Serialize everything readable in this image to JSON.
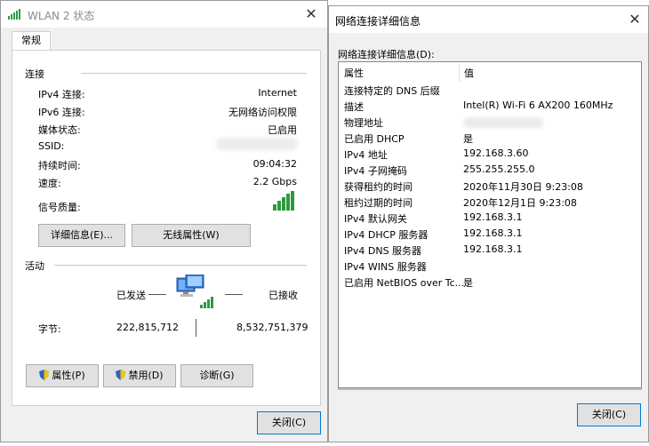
{
  "wlan_window": {
    "title": "WLAN 2 状态",
    "close_glyph": "✕",
    "tab": "常规",
    "connection": {
      "heading": "连接",
      "rows": [
        {
          "label": "IPv4 连接:",
          "value": "Internet"
        },
        {
          "label": "IPv6 连接:",
          "value": "无网络访问权限"
        },
        {
          "label": "媒体状态:",
          "value": "已启用"
        },
        {
          "label": "SSID:",
          "value": ""
        },
        {
          "label": "持续时间:",
          "value": "09:04:32"
        },
        {
          "label": "速度:",
          "value": "2.2 Gbps"
        },
        {
          "label": "信号质量:",
          "value": ""
        }
      ],
      "signal_bars": 5,
      "signal_color": "#2e9a3e"
    },
    "details_button": "详细信息(E)...",
    "wireless_props_button": "无线属性(W)",
    "activity": {
      "heading": "活动",
      "sent_label": "已发送",
      "received_label": "已接收",
      "bytes_label": "字节:",
      "bytes_sent": "222,815,712",
      "bytes_received": "8,532,751,379"
    },
    "properties_button": "属性(P)",
    "disable_button": "禁用(D)",
    "diagnose_button": "诊断(G)",
    "close_button": "关闭(C)"
  },
  "details_window": {
    "title": "网络连接详细信息",
    "close_glyph": "✕",
    "sub_label": "网络连接详细信息(D):",
    "col_property": "属性",
    "col_value": "值",
    "rows": [
      {
        "k": "连接特定的 DNS 后缀",
        "v": ""
      },
      {
        "k": "描述",
        "v": "Intel(R) Wi-Fi 6 AX200 160MHz"
      },
      {
        "k": "物理地址",
        "v": ""
      },
      {
        "k": "已启用 DHCP",
        "v": "是"
      },
      {
        "k": "IPv4 地址",
        "v": "192.168.3.60"
      },
      {
        "k": "IPv4 子网掩码",
        "v": "255.255.255.0"
      },
      {
        "k": "获得租约的时间",
        "v": "2020年11月30日 9:23:08"
      },
      {
        "k": "租约过期的时间",
        "v": "2020年12月1日 9:23:08"
      },
      {
        "k": "IPv4 默认网关",
        "v": "192.168.3.1"
      },
      {
        "k": "IPv4 DHCP 服务器",
        "v": "192.168.3.1"
      },
      {
        "k": "IPv4 DNS 服务器",
        "v": "192.168.3.1"
      },
      {
        "k": "IPv4 WINS 服务器",
        "v": ""
      },
      {
        "k": "已启用 NetBIOS over Tc...",
        "v": "是"
      }
    ],
    "close_button": "关闭(C)"
  }
}
